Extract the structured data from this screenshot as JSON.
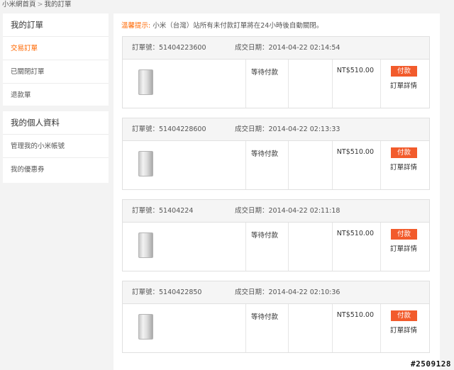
{
  "breadcrumb": {
    "home": "小米網首頁",
    "separator": ">",
    "current": "我的訂單"
  },
  "sidebar": {
    "orders_title": "我的訂單",
    "orders_items": [
      {
        "label": "交易訂單",
        "active": true
      },
      {
        "label": "已關閉訂單",
        "active": false
      },
      {
        "label": "退款單",
        "active": false
      }
    ],
    "profile_title": "我的個人資料",
    "profile_items": [
      {
        "label": "管理我的小米帳號"
      },
      {
        "label": "我的優惠券"
      }
    ]
  },
  "notice": {
    "label": "溫馨提示:",
    "text": "小米（台灣）站所有未付款訂單將在24小時後自動關閉。"
  },
  "orders": [
    {
      "number_label": "訂單號：",
      "number": "51404223600",
      "date_label": "成交日期：",
      "date": "2014-04-22 02:14:54",
      "status": "等待付款",
      "price": "NT$510.00",
      "pay_label": "付款",
      "detail_label": "訂單詳情"
    },
    {
      "number_label": "訂單號：",
      "number": "51404228600",
      "date_label": "成交日期：",
      "date": "2014-04-22 02:13:33",
      "status": "等待付款",
      "price": "NT$510.00",
      "pay_label": "付款",
      "detail_label": "訂單詳情"
    },
    {
      "number_label": "訂單號：",
      "number": "51404224",
      "date_label": "成交日期：",
      "date": "2014-04-22 02:11:18",
      "status": "等待付款",
      "price": "NT$510.00",
      "pay_label": "付款",
      "detail_label": "訂單詳情"
    },
    {
      "number_label": "訂單號：",
      "number": "5140422850",
      "date_label": "成交日期：",
      "date": "2014-04-22 02:10:36",
      "status": "等待付款",
      "price": "NT$510.00",
      "pay_label": "付款",
      "detail_label": "訂單詳情"
    }
  ],
  "watermark": "#2509128",
  "colors": {
    "accent": "#ff6700",
    "pay_button": "#f25b2c"
  }
}
